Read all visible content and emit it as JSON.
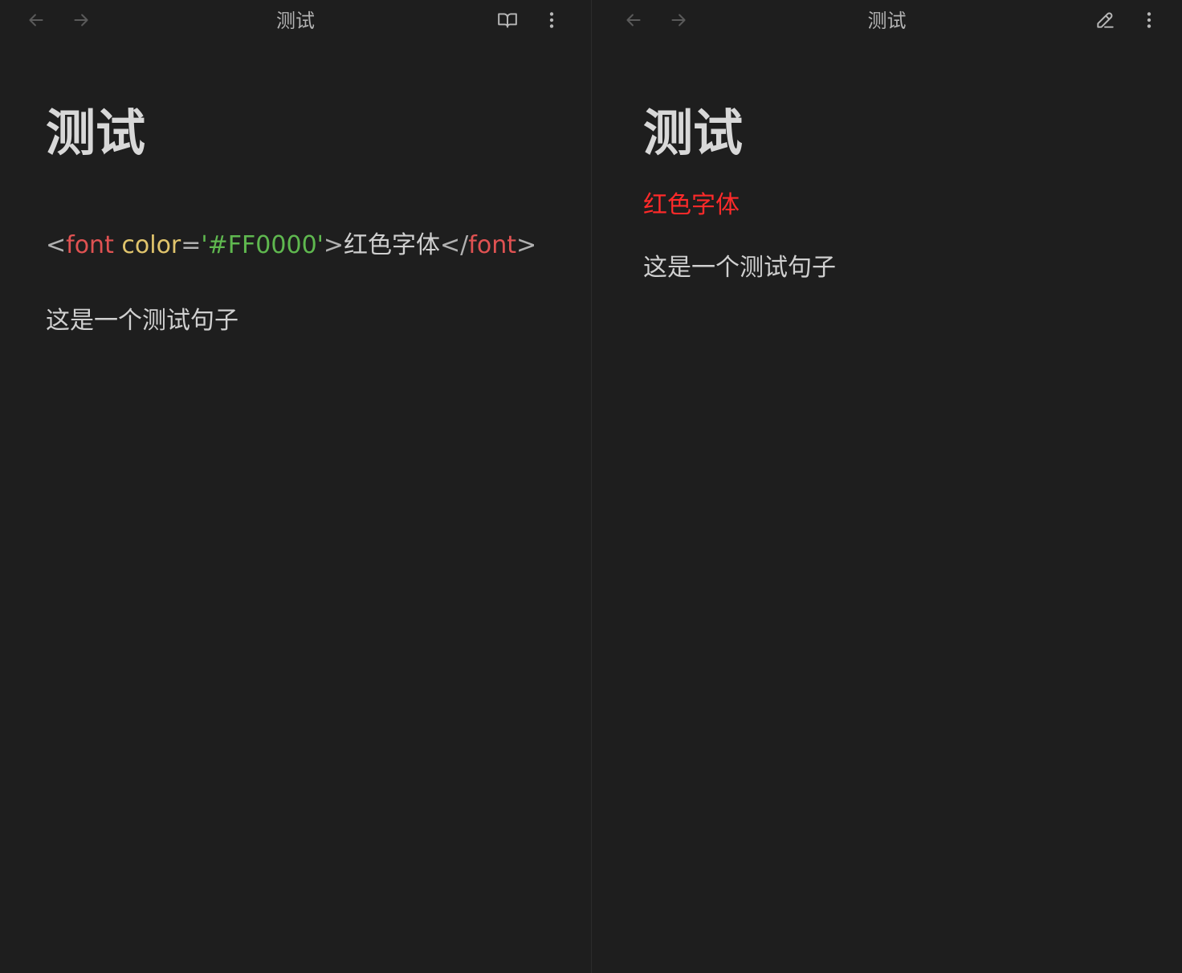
{
  "left_pane": {
    "header": {
      "title": "测试",
      "back_icon": "arrow-left-icon",
      "forward_icon": "arrow-right-icon",
      "mode_icon": "book-open-icon",
      "menu_icon": "more-vertical-icon"
    },
    "heading": "测试",
    "source": {
      "open_bracket": "<",
      "tag_open": "font",
      "attr_name": "color",
      "equals": "=",
      "attr_value": "'#FF0000'",
      "close_bracket": ">",
      "inner_text": "红色字体",
      "end_open_bracket": "</",
      "tag_close": "font",
      "end_close_bracket": ">"
    },
    "paragraph": "这是一个测试句子"
  },
  "right_pane": {
    "header": {
      "title": "测试",
      "back_icon": "arrow-left-icon",
      "forward_icon": "arrow-right-icon",
      "mode_icon": "pencil-icon",
      "menu_icon": "more-vertical-icon"
    },
    "heading": "测试",
    "red_text": "红色字体",
    "paragraph": "这是一个测试句子"
  },
  "colors": {
    "background": "#1e1e1e",
    "red_font": "#FF0000",
    "tag": "#e05252",
    "attr": "#e0c46c",
    "string": "#5fb84f"
  }
}
